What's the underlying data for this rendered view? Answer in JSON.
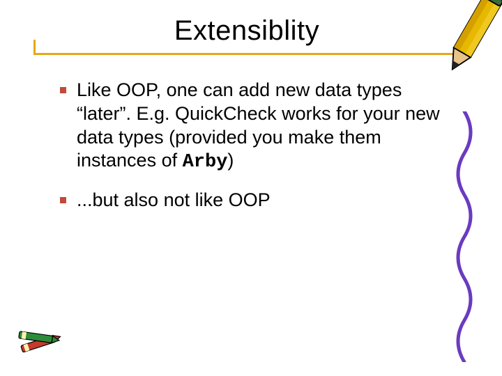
{
  "title": "Extensiblity",
  "bullets": [
    {
      "pre": "Like OOP, one can add new data types “later”.  E.g. QuickCheck works for your new data types (provided you make them instances of ",
      "code": "Arby",
      "post": ")"
    },
    {
      "pre": "...but also not like OOP",
      "code": "",
      "post": ""
    }
  ],
  "colors": {
    "accent": "#e6a817",
    "bullet": "#c24a3a"
  }
}
